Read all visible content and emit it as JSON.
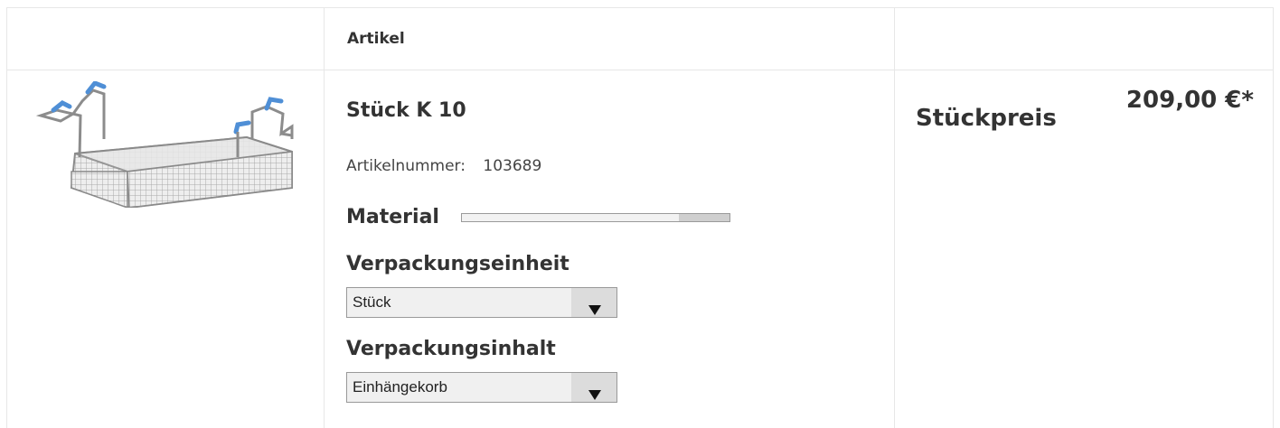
{
  "table": {
    "headers": {
      "image": "",
      "article": "Artikel",
      "price": "Stückpreis"
    }
  },
  "product": {
    "title": "Stück K 10",
    "article_number_label": "Artikelnummer:",
    "article_number": "103689",
    "image_icon": "wire-basket-image",
    "price": "209,00 €*",
    "material": {
      "label": "Material",
      "level_percent": 81
    },
    "packaging_unit": {
      "label": "Verpackungseinheit",
      "selected": "Stück"
    },
    "packaging_content": {
      "label": "Verpackungsinhalt",
      "selected": "Einhängekorb"
    }
  },
  "colors": {
    "basket_handle_accent": "#4f8fd6",
    "text": "#333333",
    "border": "#e7e7e7"
  }
}
